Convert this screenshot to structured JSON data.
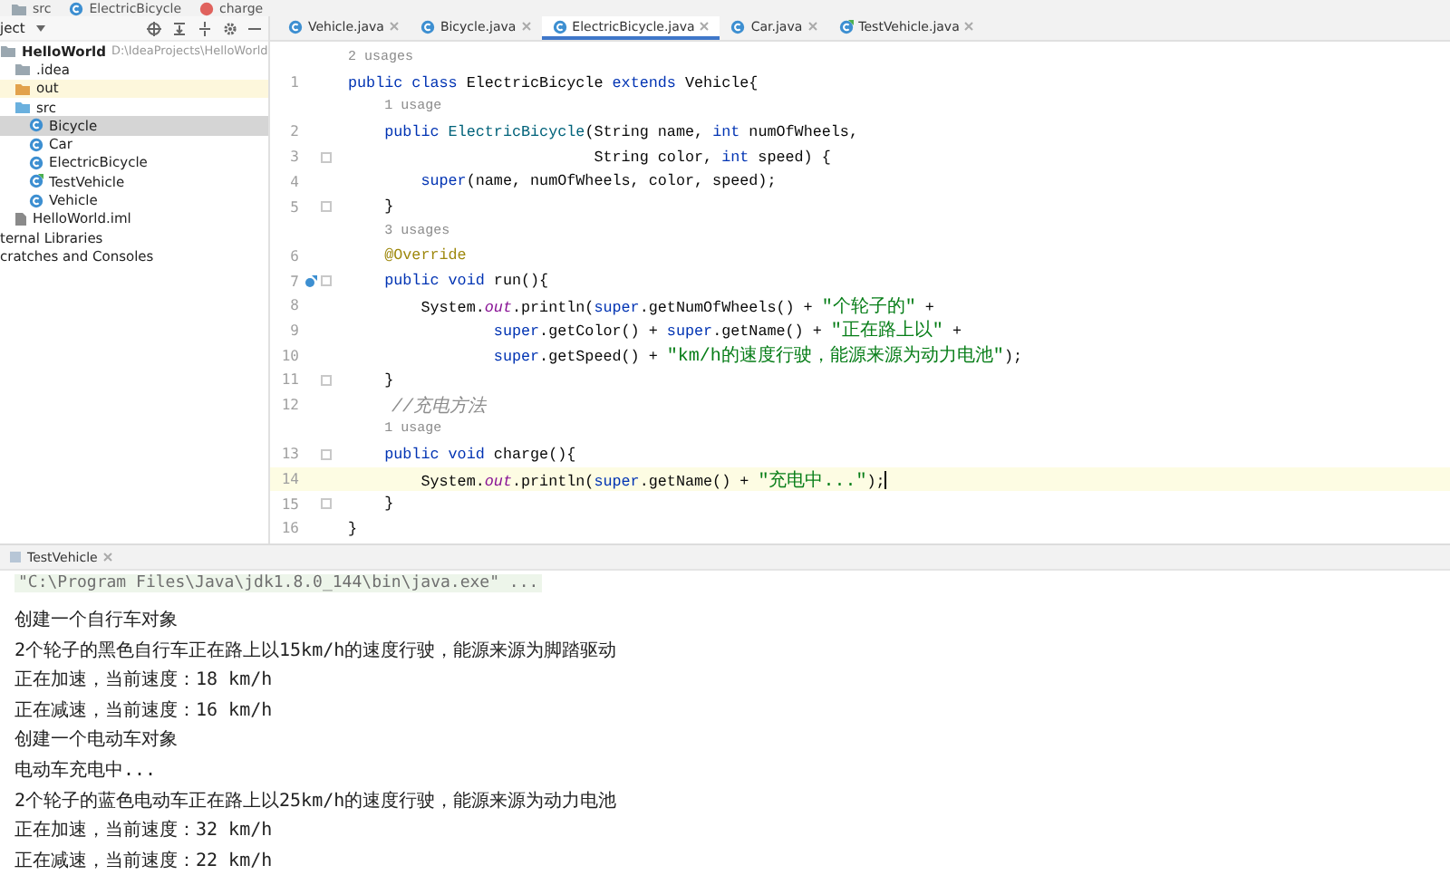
{
  "breadcrumb": [
    {
      "text": "src",
      "kind": "folder"
    },
    {
      "text": "ElectricBicycle",
      "kind": "class"
    },
    {
      "text": "charge",
      "kind": "method"
    }
  ],
  "project_panel": {
    "title": "ject",
    "tree": [
      {
        "label": "HelloWorld",
        "path": "D:\\IdeaProjects\\HelloWorld",
        "kind": "module",
        "selected": false,
        "children": [
          {
            "label": ".idea",
            "kind": "folder",
            "selected": false
          },
          {
            "label": "out",
            "kind": "excluded",
            "selected": false
          },
          {
            "label": "src",
            "kind": "source",
            "selected": false,
            "children": [
              {
                "label": "Bicycle",
                "kind": "class",
                "selected": true
              },
              {
                "label": "Car",
                "kind": "class",
                "selected": false
              },
              {
                "label": "ElectricBicycle",
                "kind": "class",
                "selected": false
              },
              {
                "label": "TestVehicle",
                "kind": "main",
                "selected": false
              },
              {
                "label": "Vehicle",
                "kind": "class",
                "selected": false
              }
            ]
          },
          {
            "label": "HelloWorld.iml",
            "kind": "file",
            "selected": false
          }
        ]
      },
      {
        "label": "ternal Libraries",
        "kind": "plain",
        "selected": false
      },
      {
        "label": "cratches and Consoles",
        "kind": "plain",
        "selected": false
      }
    ]
  },
  "editor_tabs": [
    {
      "label": "Vehicle.java",
      "kind": "class",
      "selected": false
    },
    {
      "label": "Bicycle.java",
      "kind": "class",
      "selected": false
    },
    {
      "label": "ElectricBicycle.java",
      "kind": "class",
      "selected": true
    },
    {
      "label": "Car.java",
      "kind": "class",
      "selected": false
    },
    {
      "label": "TestVehicle.java",
      "kind": "main",
      "selected": false
    }
  ],
  "editor": {
    "lines": [
      {
        "kind": "hint",
        "text": "2 usages"
      },
      {
        "kind": "code",
        "number": "1",
        "tokens": [
          {
            "kind": "kw",
            "s": "public class "
          },
          {
            "kind": "plain",
            "s": "ElectricBicycle "
          },
          {
            "kind": "kw",
            "s": "extends "
          },
          {
            "kind": "plain",
            "s": "Vehicle{"
          }
        ]
      },
      {
        "kind": "hint",
        "text": "1 usage"
      },
      {
        "kind": "code",
        "number": "2",
        "tokens": [
          {
            "kind": "kw",
            "s": "    public "
          },
          {
            "kind": "fn",
            "s": "ElectricBicycle"
          },
          {
            "kind": "plain",
            "s": "(String name, "
          },
          {
            "kind": "kw",
            "s": "int "
          },
          {
            "kind": "plain",
            "s": "numOfWheels,"
          }
        ]
      },
      {
        "kind": "code",
        "number": "3",
        "fold": true,
        "tokens": [
          {
            "kind": "plain",
            "s": "                           String color, "
          },
          {
            "kind": "kw",
            "s": "int "
          },
          {
            "kind": "plain",
            "s": "speed) {"
          }
        ]
      },
      {
        "kind": "code",
        "number": "4",
        "tokens": [
          {
            "kind": "kw",
            "s": "        super"
          },
          {
            "kind": "plain",
            "s": "(name, numOfWheels, color, speed);"
          }
        ]
      },
      {
        "kind": "code",
        "number": "5",
        "fold": true,
        "tokens": [
          {
            "kind": "plain",
            "s": "    }"
          }
        ]
      },
      {
        "kind": "hint",
        "text": "3 usages"
      },
      {
        "kind": "code",
        "number": "6",
        "tokens": [
          {
            "kind": "annotation",
            "s": "    @Override"
          }
        ]
      },
      {
        "kind": "code",
        "number": "7",
        "fold": true,
        "override": true,
        "tokens": [
          {
            "kind": "kw",
            "s": "    public void "
          },
          {
            "kind": "plain",
            "s": "run(){"
          }
        ]
      },
      {
        "kind": "code",
        "number": "8",
        "tokens": [
          {
            "kind": "plain",
            "s": "        System."
          },
          {
            "kind": "field",
            "s": "out"
          },
          {
            "kind": "plain",
            "s": ".println("
          },
          {
            "kind": "kw",
            "s": "super"
          },
          {
            "kind": "plain",
            "s": ".getNumOfWheels() + "
          },
          {
            "kind": "str",
            "s": "\"个轮子的\""
          },
          {
            "kind": "plain",
            "s": " +"
          }
        ]
      },
      {
        "kind": "code",
        "number": "9",
        "tokens": [
          {
            "kind": "kw",
            "s": "                super"
          },
          {
            "kind": "plain",
            "s": ".getColor() + "
          },
          {
            "kind": "kw",
            "s": "super"
          },
          {
            "kind": "plain",
            "s": ".getName() + "
          },
          {
            "kind": "str",
            "s": "\"正在路上以\""
          },
          {
            "kind": "plain",
            "s": " +"
          }
        ]
      },
      {
        "kind": "code",
        "number": "10",
        "tokens": [
          {
            "kind": "kw",
            "s": "                super"
          },
          {
            "kind": "plain",
            "s": ".getSpeed() + "
          },
          {
            "kind": "str",
            "s": "\"km/h的速度行驶，能源来源为动力电池\""
          },
          {
            "kind": "plain",
            "s": ");"
          }
        ]
      },
      {
        "kind": "code",
        "number": "11",
        "fold": true,
        "tokens": [
          {
            "kind": "plain",
            "s": "    }"
          }
        ]
      },
      {
        "kind": "code",
        "number": "12",
        "tokens": [
          {
            "kind": "comment",
            "s": "    //充电方法"
          }
        ]
      },
      {
        "kind": "hint",
        "text": "1 usage"
      },
      {
        "kind": "code",
        "number": "13",
        "fold": true,
        "tokens": [
          {
            "kind": "kw",
            "s": "    public void "
          },
          {
            "kind": "plain",
            "s": "charge(){"
          }
        ]
      },
      {
        "kind": "code",
        "number": "14",
        "current": true,
        "tokens": [
          {
            "kind": "plain",
            "s": "        System."
          },
          {
            "kind": "field",
            "s": "out"
          },
          {
            "kind": "plain",
            "s": ".println("
          },
          {
            "kind": "kw",
            "s": "super"
          },
          {
            "kind": "plain",
            "s": ".getName() + "
          },
          {
            "kind": "str",
            "s": "\"充电中...\""
          },
          {
            "kind": "plain",
            "s": ");"
          }
        ]
      },
      {
        "kind": "code",
        "number": "15",
        "fold": true,
        "tokens": [
          {
            "kind": "plain",
            "s": "    }"
          }
        ]
      },
      {
        "kind": "code",
        "number": "16",
        "tokens": [
          {
            "kind": "plain",
            "s": "}"
          }
        ]
      }
    ]
  },
  "run_console": {
    "tab": "TestVehicle",
    "lines": [
      {
        "kind": "command",
        "text": "\"C:\\Program Files\\Java\\jdk1.8.0_144\\bin\\java.exe\" ..."
      },
      {
        "kind": "output",
        "text": "创建一个自行车对象"
      },
      {
        "kind": "output",
        "text": "2个轮子的黑色自行车正在路上以15km/h的速度行驶，能源来源为脚踏驱动"
      },
      {
        "kind": "output",
        "text": "正在加速，当前速度：18 km/h"
      },
      {
        "kind": "output",
        "text": "正在减速，当前速度：16 km/h"
      },
      {
        "kind": "output",
        "text": "创建一个电动车对象"
      },
      {
        "kind": "output",
        "text": "电动车充电中..."
      },
      {
        "kind": "output",
        "text": "2个轮子的蓝色电动车正在路上以25km/h的速度行驶，能源来源为动力电池"
      },
      {
        "kind": "output",
        "text": "正在加速，当前速度：32 km/h"
      },
      {
        "kind": "output",
        "text": "正在减速，当前速度：22 km/h"
      }
    ]
  }
}
